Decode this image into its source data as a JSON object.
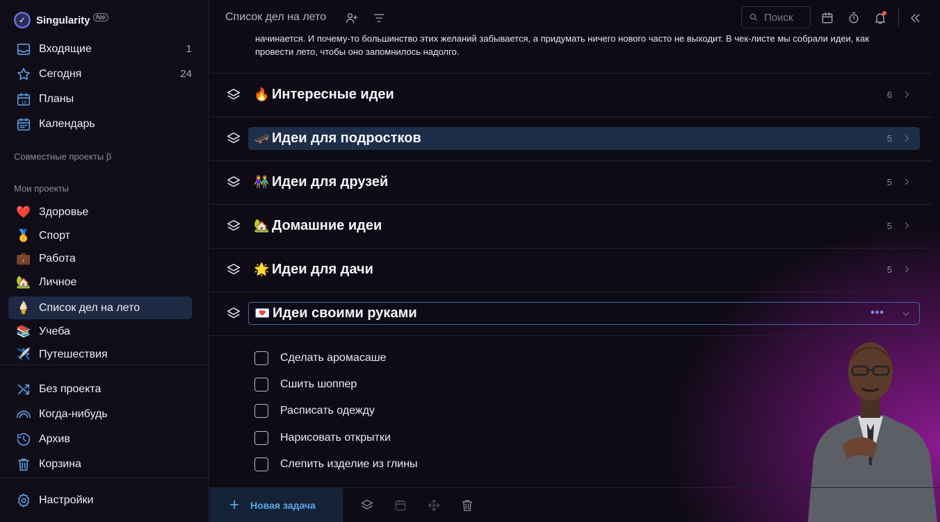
{
  "app": {
    "name": "Singularity",
    "badge": "App"
  },
  "nav": [
    {
      "label": "Входящие",
      "count": "1",
      "icon": "inbox-icon"
    },
    {
      "label": "Сегодня",
      "count": "24",
      "icon": "star-icon"
    },
    {
      "label": "Планы",
      "count": "",
      "icon": "calendar-10-icon"
    },
    {
      "label": "Календарь",
      "count": "",
      "icon": "calendar-grid-icon"
    }
  ],
  "sections": {
    "shared": "Совместные проекты β",
    "mine": "Мои проекты"
  },
  "projects": [
    {
      "emoji": "❤️",
      "label": "Здоровье"
    },
    {
      "emoji": "🥇",
      "label": "Спорт"
    },
    {
      "emoji": "💼",
      "label": "Работа"
    },
    {
      "emoji": "🏡",
      "label": "Личное"
    },
    {
      "emoji": "🍦",
      "label": "Список дел на лето"
    },
    {
      "emoji": "📚",
      "label": "Учеба"
    },
    {
      "emoji": "✈️",
      "label": "Путешествия"
    }
  ],
  "nav_bottom": [
    {
      "label": "Без проекта",
      "icon": "shuffle-icon"
    },
    {
      "label": "Когда-нибудь",
      "icon": "rainbow-icon"
    },
    {
      "label": "Архив",
      "icon": "history-icon"
    },
    {
      "label": "Корзина",
      "icon": "trash-icon"
    }
  ],
  "settings": {
    "label": "Настройки",
    "icon": "gear-icon"
  },
  "header": {
    "title": "Список дел на лето",
    "search_placeholder": "Поиск"
  },
  "description": "начинается. И почему-то большинство этих желаний забывается, а придумать ничего нового часто не выходит. В чек-листе мы собрали идеи, как провести лето, чтобы оно запомнилось надолго.",
  "groups": [
    {
      "emoji": "🔥",
      "title": "Интересные идеи",
      "count": "6"
    },
    {
      "emoji": "🛹",
      "title": "Идеи для подростков",
      "count": "5"
    },
    {
      "emoji": "👫",
      "title": "Идеи для друзей",
      "count": "5"
    },
    {
      "emoji": "🏡",
      "title": "Домашние идеи",
      "count": "5"
    },
    {
      "emoji": "🌟",
      "title": "Идеи для дачи",
      "count": "5"
    },
    {
      "emoji": "💌",
      "title": "Идеи своими руками",
      "count": ""
    }
  ],
  "tasks": [
    "Сделать аромасаше",
    "Сшить шоппер",
    "Расписать одежду",
    "Нарисовать открытки",
    "Слепить изделие из глины"
  ],
  "bottom": {
    "new_task": "Новая задача"
  },
  "colors": {
    "accent": "#5aa7ea",
    "highlight": "#1d2e4a",
    "background": "#0f0b16",
    "glow": "#8a1a8e"
  }
}
